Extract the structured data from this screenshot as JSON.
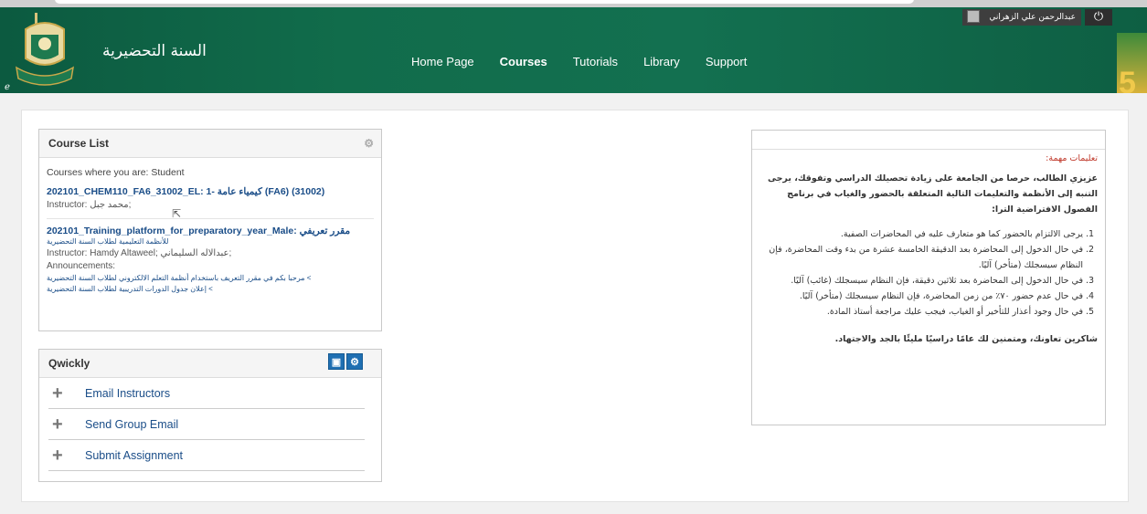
{
  "header": {
    "site_title": "السنة التحضيرية",
    "nav": [
      "Home Page",
      "Courses",
      "Tutorials",
      "Library",
      "Support"
    ],
    "active_nav": "Courses",
    "user_name": "عبدالرحمن علي الزهراني",
    "power_icon": "power-icon",
    "badge_text": "5",
    "brand_color": "#116c4b"
  },
  "course_list": {
    "title": "Course List",
    "role_line": "Courses where you are: Student",
    "courses": [
      {
        "link": "202101_CHEM110_FA6_31002_EL: 1- كيمياء عامة (FA6) (31002)",
        "instructor_label": "Instructor:",
        "instructor": "محمد جبل;"
      },
      {
        "link": "202101_Training_platform_for_preparatory_year_Male: مقرر تعريفي",
        "subtitle": "للأنظمة التعليمية لطلاب السنة التحضيرية",
        "instructor_label": "Instructor:",
        "instructor": "Hamdy Altaweel; عبدالاله السليماني;",
        "announcements_label": "Announcements:",
        "announcements": [
          "مرحبا بكم في مقرر التعريف باستخدام أنظمة التعلم الالكتروني لطلاب السنة التحضيرية <",
          "إعلان جدول الدورات التدريبية لطلاب السنة التحضيرية <"
        ]
      }
    ]
  },
  "qwickly": {
    "title": "Qwickly",
    "items": [
      "Email Instructors",
      "Send Group Email",
      "Submit Assignment"
    ]
  },
  "notice": {
    "title": "تعليمات مهمة:",
    "intro": "عزيزي الطالب، حرصا من الجامعة على زيادة تحصيلك الدراسي وتفوقك، يرجى التنبه إلى الأنظمة والتعليمات التالية المتعلقة بالحضور والغياب في برنامج الفصول الافتراضية الترا:",
    "items": [
      "يرجى الالتزام بالحضور كما هو متعارف عليه في المحاضرات الصفية.",
      "في حال الدخول إلى المحاضرة بعد الدقيقة الخامسة عشرة من بدء وقت المحاضرة، فإن النظام سيسجلك (متأخر) آليًا.",
      "في حال الدخول إلى المحاضرة بعد ثلاثين دقيقة، فإن النظام سيسجلك (غائب) آليًا.",
      "في حال عدم حضور ٧٠٪ من زمن المحاضرة، فإن النظام سيسجلك (متأخر) آليًا.",
      "في حال وجود أعذار للتأخير أو الغياب، فيجب عليك مراجعة أستاذ المادة."
    ],
    "thanks": "شاكرين تعاونك، ومتمنين لك عامًا دراسيًا مليئًا بالجد والاجتهاد."
  }
}
